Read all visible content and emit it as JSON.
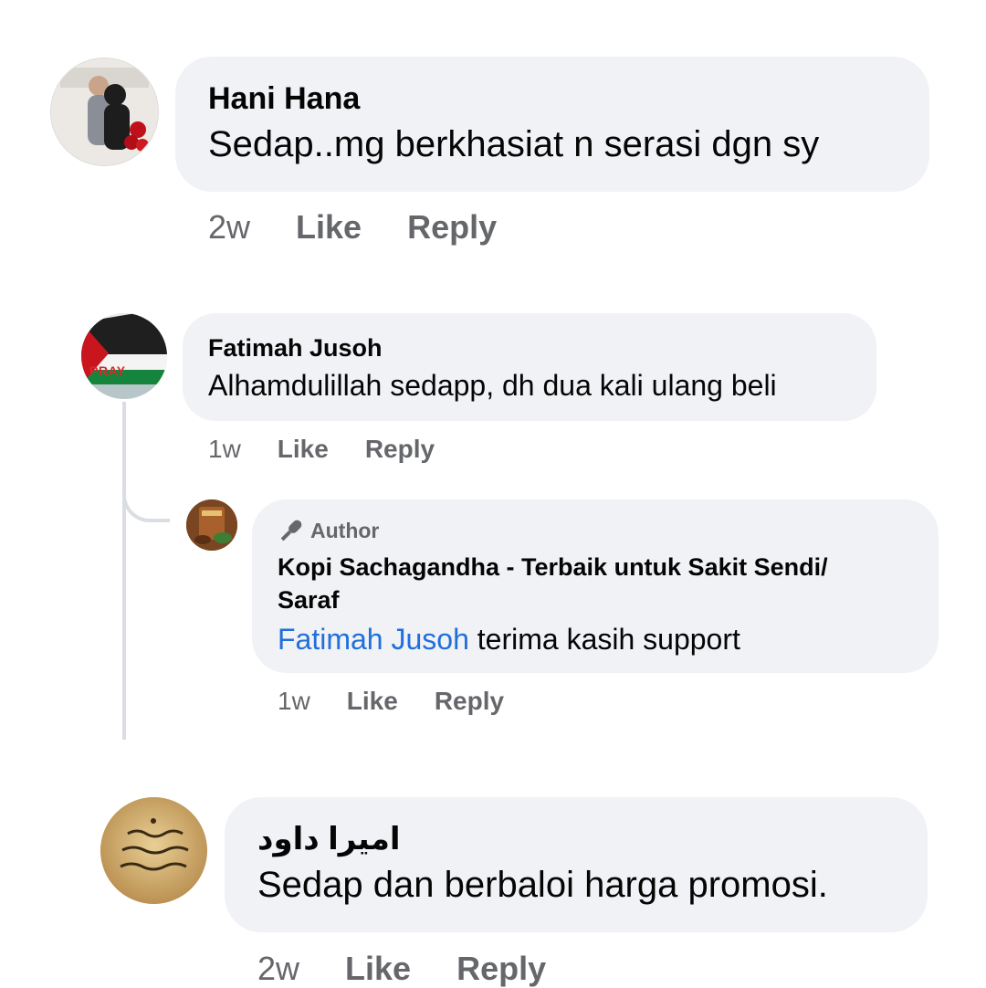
{
  "comments": [
    {
      "author": "Hani Hana",
      "text": "Sedap..mg berkhasiat n serasi dgn sy",
      "time": "2w",
      "like": "Like",
      "reply": "Reply"
    },
    {
      "author": "Fatimah Jusoh",
      "text": "Alhamdulillah sedapp, dh dua kali ulang beli",
      "time": "1w",
      "like": "Like",
      "reply": "Reply",
      "avatar_text": "PRAY"
    },
    {
      "author": "اميرا داود",
      "text": "Sedap dan berbaloi harga promosi.",
      "time": "2w",
      "like": "Like",
      "reply": "Reply"
    }
  ],
  "reply": {
    "badge": "Author",
    "author_line1": "Kopi Sachagandha - Terbaik untuk Sakit Sendi/",
    "author_line2": "Saraf",
    "mention": "Fatimah Jusoh",
    "text": " terima kasih support",
    "time": "1w",
    "like": "Like",
    "reply": "Reply"
  },
  "colors": {
    "bubble": "#f0f2f5",
    "meta": "#65676b",
    "mention": "#216fdb"
  }
}
